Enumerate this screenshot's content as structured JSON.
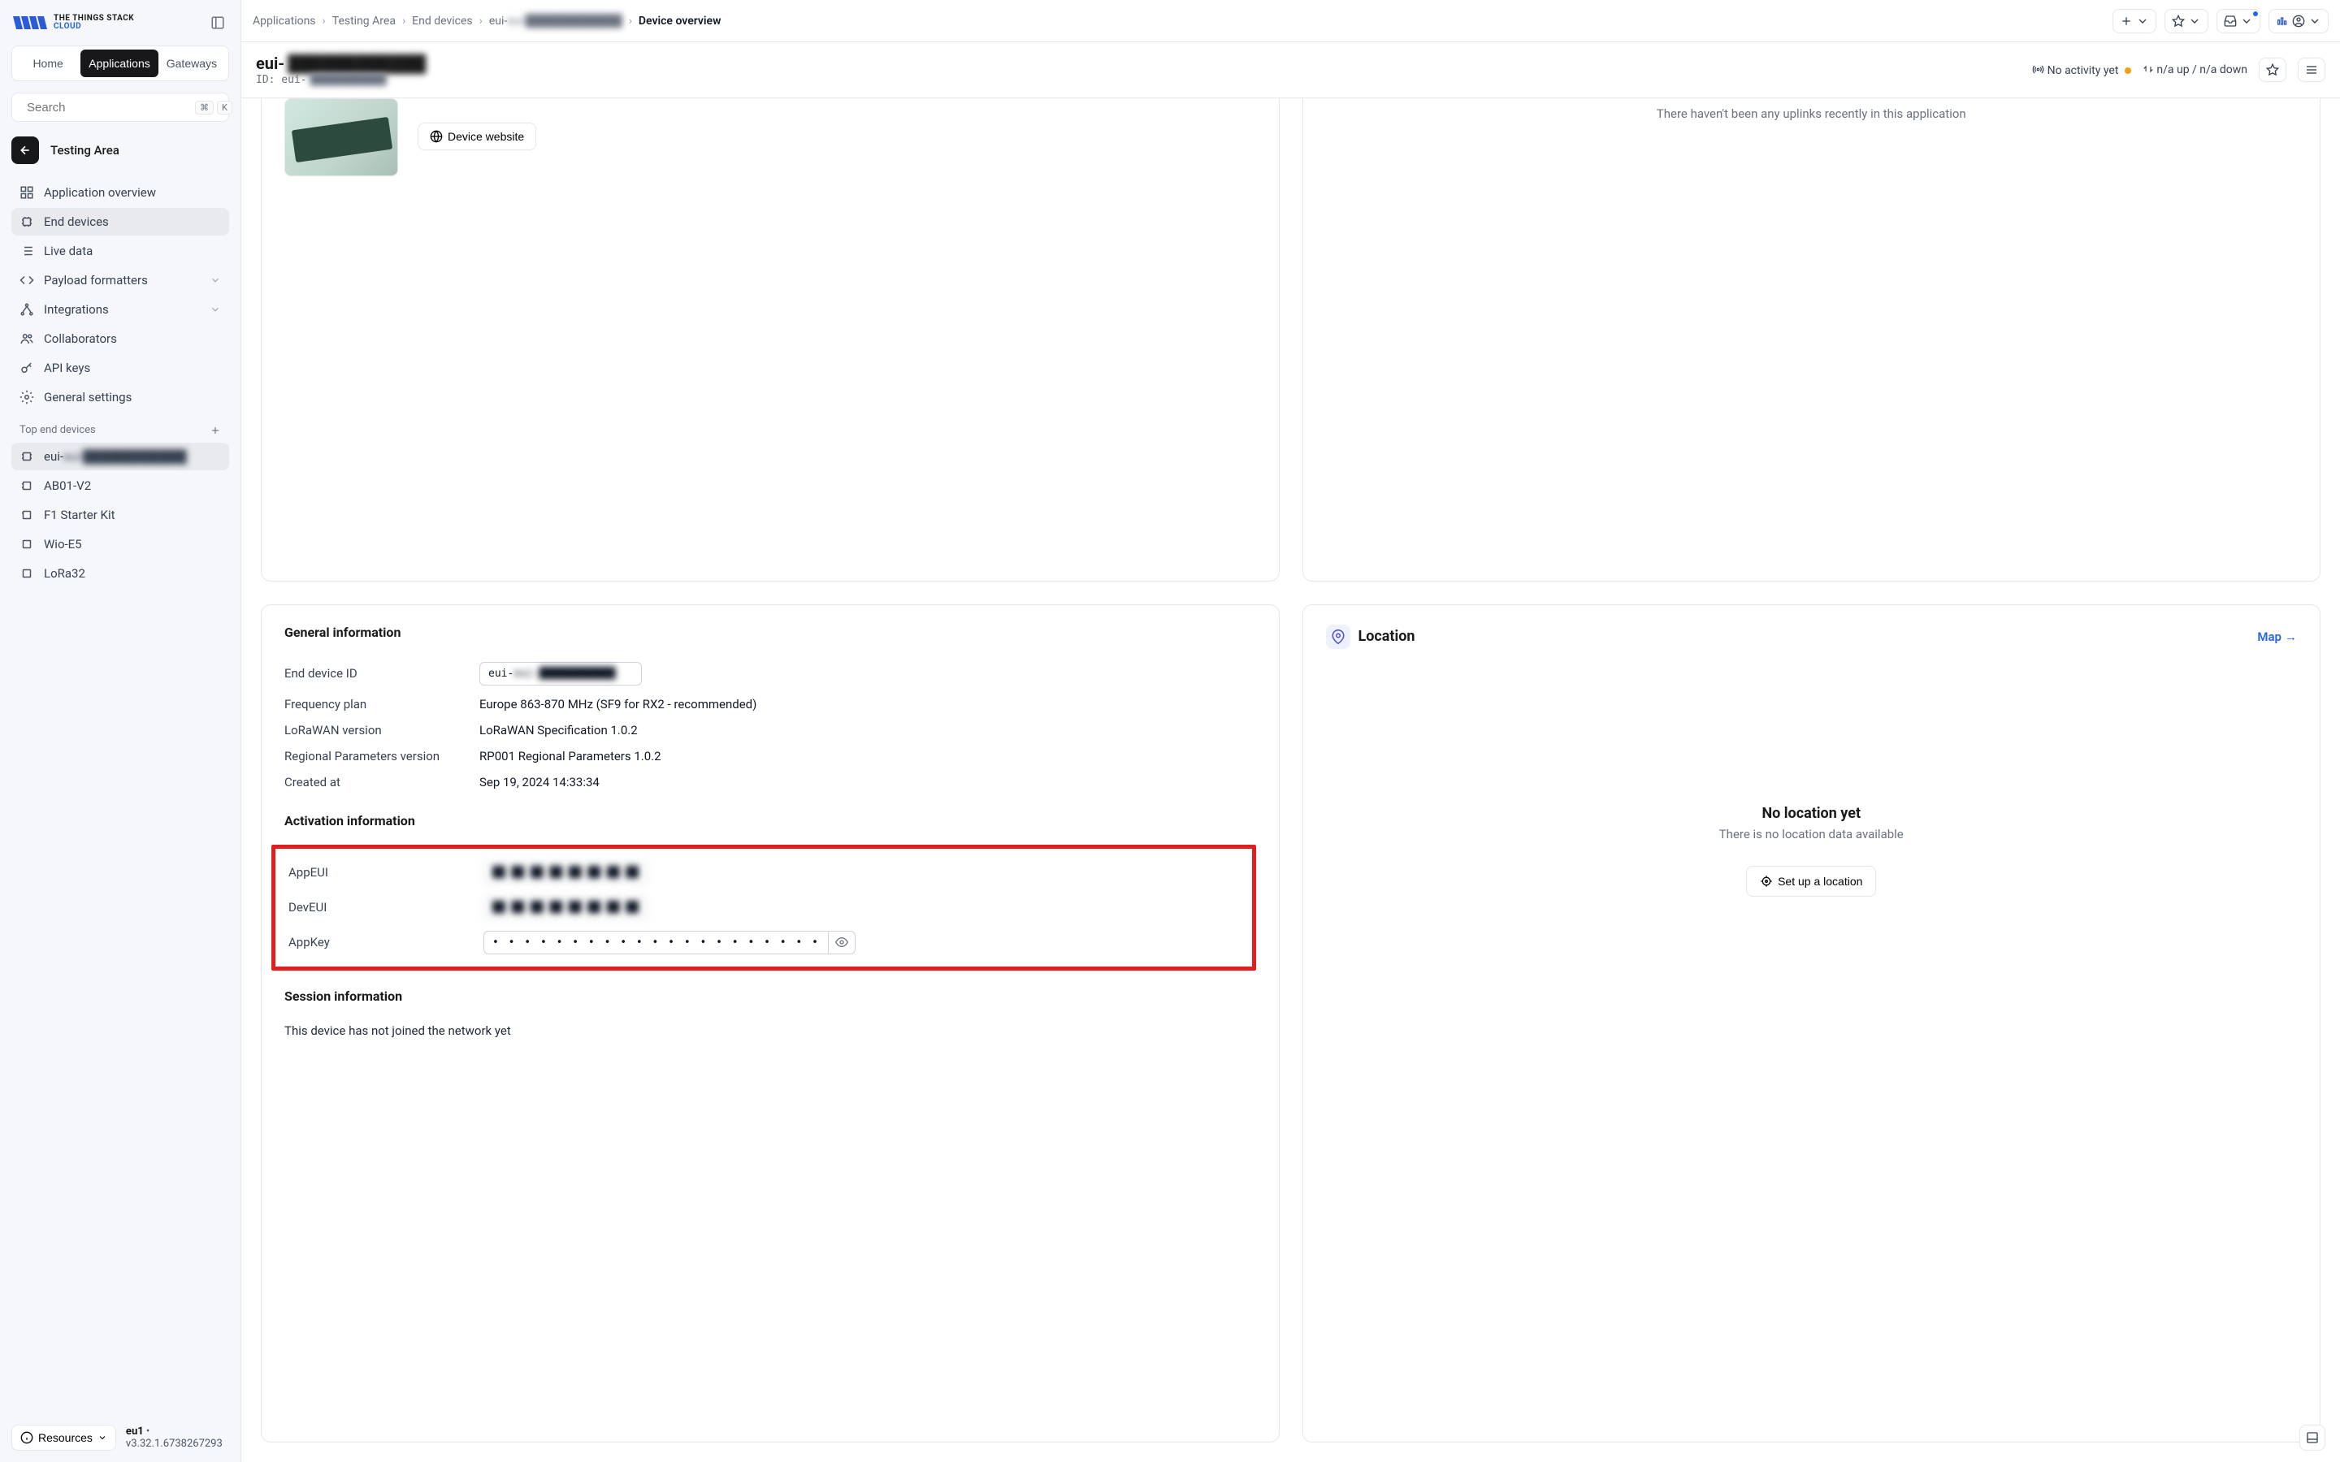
{
  "brand": {
    "line1": "THE THINGS STACK",
    "line2": "CLOUD"
  },
  "tabs": {
    "home": "Home",
    "applications": "Applications",
    "gateways": "Gateways"
  },
  "search": {
    "placeholder": "Search",
    "kbd1": "⌘",
    "kbd2": "K"
  },
  "context": {
    "name": "Testing Area"
  },
  "nav": {
    "overview": "Application overview",
    "end_devices": "End devices",
    "live_data": "Live data",
    "payload": "Payload formatters",
    "integrations": "Integrations",
    "collaborators": "Collaborators",
    "api_keys": "API keys",
    "settings": "General settings"
  },
  "top_devices": {
    "label": "Top end devices",
    "items": [
      "eui-████████████",
      "AB01-V2",
      "F1 Starter Kit",
      "Wio-E5",
      "LoRa32"
    ]
  },
  "footer": {
    "resources": "Resources",
    "region": "eu1",
    "version": "v3.32.1.6738267293"
  },
  "breadcrumb": {
    "applications": "Applications",
    "area": "Testing Area",
    "end": "End devices",
    "device": "eui-████████████",
    "current": "Device overview"
  },
  "header": {
    "title_prefix": "eui-",
    "title_redacted": "████████████",
    "id_prefix": "ID: eui-",
    "id_redacted": "████████████",
    "no_activity": "No activity yet",
    "updown": "n/a up / n/a down"
  },
  "device_card": {
    "website_btn": "Device website"
  },
  "uplinks": {
    "empty": "There haven't been any uplinks recently in this application"
  },
  "general": {
    "title": "General information",
    "labels": {
      "id": "End device ID",
      "freq": "Frequency plan",
      "lwv": "LoRaWAN version",
      "rpv": "Regional Parameters version",
      "created": "Created at"
    },
    "values": {
      "id": "eui-████████████",
      "freq": "Europe 863-870 MHz (SF9 for RX2 - recommended)",
      "lwv": "LoRaWAN Specification 1.0.2",
      "rpv": "RP001 Regional Parameters 1.0.2",
      "created": "Sep 19, 2024 14:33:34"
    }
  },
  "activation": {
    "title": "Activation information",
    "labels": {
      "appeui": "AppEUI",
      "deveui": "DevEUI",
      "appkey": "AppKey"
    },
    "values": {
      "appeui": "██ ██ ██ ██ ██ ██ ██ ██",
      "deveui": "██ ██ ██ ██ ██ ██ ██ ██",
      "appkey": "• •  • •  • •  • •  • •  • •  • •  • •  • •  • •  •"
    }
  },
  "session": {
    "title": "Session information",
    "text": "This device has not joined the network yet"
  },
  "location": {
    "title": "Location",
    "map_link": "Map",
    "empty_title": "No location yet",
    "empty_text": "There is no location data available",
    "btn": "Set up a location"
  }
}
